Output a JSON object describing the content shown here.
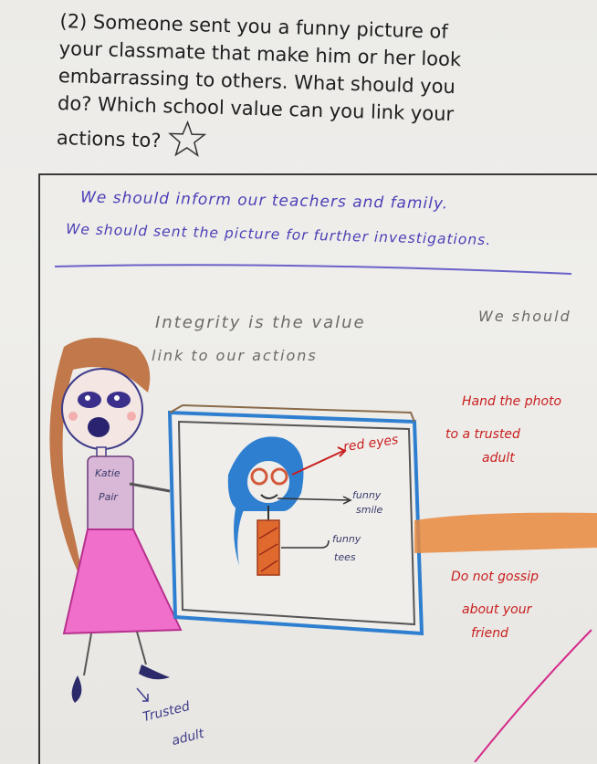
{
  "question": {
    "lines": [
      "(2)  Someone sent you a funny picture of",
      "your classmate that make him or her look",
      "embarrassing to others. What should you",
      "do? Which school value can you link your",
      "actions to?"
    ],
    "star_icon": "star-outline-icon"
  },
  "answer": {
    "line1": "We should inform  our  teachers and family.",
    "line2": "We should sent the picture for  further investigations."
  },
  "integrity": {
    "line1": "Integrity  is  the  value",
    "line1b": "We should",
    "line2": "link  to  our  actions"
  },
  "drawing": {
    "badge_text": [
      "Katie",
      "Pair"
    ],
    "red_eyes": "red eyes",
    "funny_smile": [
      "funny",
      "smile"
    ],
    "funny_tees": [
      "funny",
      "tees"
    ],
    "hand_photo": [
      "Hand the photo",
      "to a trusted",
      "adult"
    ],
    "no_gossip": [
      "Do  not gossip",
      "about your",
      "friend"
    ],
    "trusted_adult": [
      "Trusted",
      "adult"
    ]
  },
  "colors": {
    "ink_blue": "#4b3fb6",
    "ink_red": "#c81e1e",
    "pink_skirt": "#e860c0",
    "orange_arm": "#e98a3e",
    "blue_frame": "#2f7fd0",
    "brown_hair": "#a8582a"
  }
}
